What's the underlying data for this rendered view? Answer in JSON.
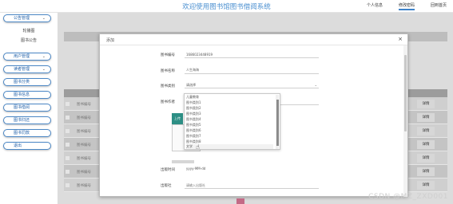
{
  "header": {
    "user_tag": "",
    "app_title": "欢迎使用图书馆图书借阅系统",
    "links": [
      "个人信息",
      "修改密码",
      "回到首页"
    ]
  },
  "sidebar": {
    "items": [
      {
        "label": "公告管理",
        "has_chevron": true
      },
      {
        "label": "轮播图",
        "sub": true
      },
      {
        "label": "图书公告",
        "sub": true
      },
      {
        "label": "用户管理",
        "has_chevron": true
      },
      {
        "label": "读者管理",
        "has_chevron": true
      },
      {
        "label": "图书分类",
        "has_chevron": false
      },
      {
        "label": "图书信息",
        "has_chevron": false
      },
      {
        "label": "图书借阅",
        "has_chevron": false
      },
      {
        "label": "图书归还",
        "has_chevron": false
      },
      {
        "label": "图书罚款",
        "has_chevron": false
      },
      {
        "label": "退出",
        "has_chevron": false
      }
    ]
  },
  "background_table": {
    "rows": [
      {
        "cell": "图书编号",
        "badge": "详情"
      },
      {
        "cell": "图书编号",
        "badge": "详情"
      },
      {
        "cell": "图书编号",
        "badge": "详情"
      },
      {
        "cell": "图书编号",
        "badge": "详情"
      },
      {
        "cell": "图书编号",
        "badge": "详情"
      },
      {
        "cell": "图书编号",
        "badge": "详情"
      },
      {
        "cell": "图书编号",
        "badge": "详情"
      }
    ]
  },
  "modal": {
    "title": "添加",
    "close": "×",
    "fields": [
      {
        "label": "图书编号",
        "value": "1686023448919"
      },
      {
        "label": "图书名称",
        "value": "人生海海"
      },
      {
        "label": "图书类别",
        "value": "请选择"
      },
      {
        "label": "图书作者",
        "value": ""
      }
    ],
    "upload_label": "上传",
    "date_field": {
      "label": "出版时间",
      "value": "yyyy-MM-dd"
    },
    "publisher_field": {
      "label": "出版社",
      "placeholder": "请输入出版社"
    }
  },
  "dropdown": {
    "options": [
      "儿童教育",
      "图书类别1",
      "图书类别2",
      "图书类别3",
      "图书类别4",
      "图书类别5",
      "图书类别6",
      "图书类别7",
      "图书类别8",
      "文学"
    ],
    "hover_index": 9
  },
  "watermark": "CSDN @MZ_ZXD001"
}
